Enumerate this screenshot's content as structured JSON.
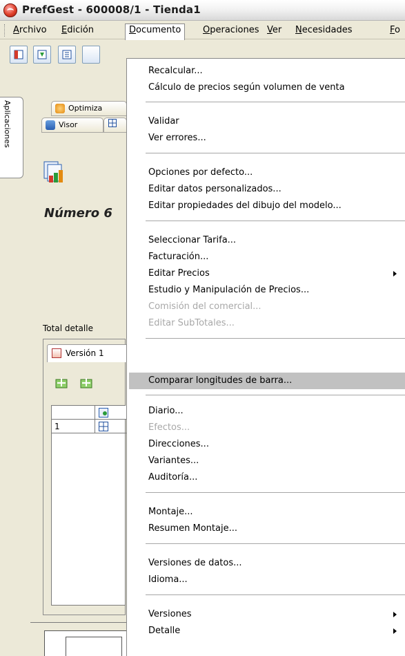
{
  "window": {
    "title": "PrefGest - 600008/1 - Tienda1"
  },
  "menubar": {
    "items": [
      "Archivo",
      "Edición",
      "Documento",
      "Operaciones",
      "Ver",
      "Necesidades",
      "Fo"
    ]
  },
  "left": {
    "vertical_tab": "Aplicaciones",
    "tab_optimiza": "Optimiza",
    "tab_visor": "Visor",
    "numero": "Número 6",
    "total_detalle": "Total detalle",
    "version_tab": "Versión 1",
    "row_number": "1"
  },
  "documento_menu": {
    "recalcular": "Recalcular...",
    "calculo_precios": "Cálculo de precios según volumen de venta",
    "validar": "Validar",
    "ver_errores": "Ver errores...",
    "opciones_defecto": "Opciones por defecto...",
    "editar_datos_pers": "Editar datos personalizados...",
    "editar_prop_dibujo": "Editar propiedades del dibujo del modelo...",
    "seleccionar_tarifa": "Seleccionar Tarifa...",
    "facturacion": "Facturación...",
    "editar_precios": "Editar Precios",
    "estudio_precios": "Estudio y Manipulación de Precios...",
    "comision": "Comisión del comercial...",
    "editar_subtotales": "Editar SubTotales...",
    "comparar_longitudes": "Comparar longitudes de barra...",
    "diario": "Diario...",
    "efectos": "Efectos...",
    "direcciones": "Direcciones...",
    "variantes": "Variantes...",
    "auditoria": "Auditoría...",
    "montaje": "Montaje...",
    "resumen_montaje": "Resumen Montaje...",
    "versiones_datos": "Versiones de datos...",
    "idioma": "Idioma...",
    "versiones": "Versiones",
    "detalle": "Detalle"
  },
  "colors": {
    "highlight": "#c1c1c1",
    "disabled_text": "#a8a8a8",
    "menu_bg": "#ffffff",
    "chrome_bg": "#ece9d8"
  },
  "icons": [
    "app-logo-icon",
    "red-window-icon",
    "arrow-down-icon",
    "list-icon",
    "optimiza-icon",
    "visor-icon",
    "document-stack-icon",
    "version-icon",
    "add-green-icon",
    "grid-icon",
    "submenu-arrow-icon"
  ]
}
